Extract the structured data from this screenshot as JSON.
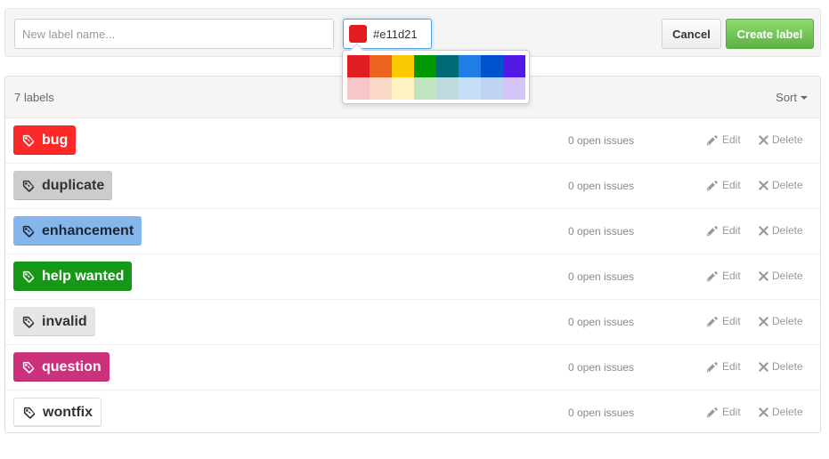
{
  "new_label": {
    "name_placeholder": "New label name...",
    "color_value": "#e11d21",
    "cancel_label": "Cancel",
    "create_label": "Create label"
  },
  "color_picker": {
    "row1": [
      "#e11d21",
      "#eb6420",
      "#fbca04",
      "#009800",
      "#006b75",
      "#207de5",
      "#0052cc",
      "#5319e7"
    ],
    "row2": [
      "#f7c6c7",
      "#fad8c7",
      "#fef2c0",
      "#bfe5bf",
      "#bfdadc",
      "#c7def8",
      "#bfd4f2",
      "#d4c5f9"
    ]
  },
  "list": {
    "count_text": "7 labels",
    "sort_label": "Sort",
    "edit_label": "Edit",
    "delete_label": "Delete",
    "labels": [
      {
        "name": "bug",
        "color": "#fc2929",
        "text_color": "#ffffff",
        "issues": "0 open issues"
      },
      {
        "name": "duplicate",
        "color": "#cccccc",
        "text_color": "#333333",
        "issues": "0 open issues"
      },
      {
        "name": "enhancement",
        "color": "#84b6eb",
        "text_color": "#1c2733",
        "issues": "0 open issues"
      },
      {
        "name": "help wanted",
        "color": "#159818",
        "text_color": "#ffffff",
        "issues": "0 open issues"
      },
      {
        "name": "invalid",
        "color": "#e6e6e6",
        "text_color": "#333333",
        "issues": "0 open issues"
      },
      {
        "name": "question",
        "color": "#cc317c",
        "text_color": "#ffffff",
        "issues": "0 open issues"
      },
      {
        "name": "wontfix",
        "color": "#ffffff",
        "text_color": "#333333",
        "issues": "0 open issues"
      }
    ]
  }
}
